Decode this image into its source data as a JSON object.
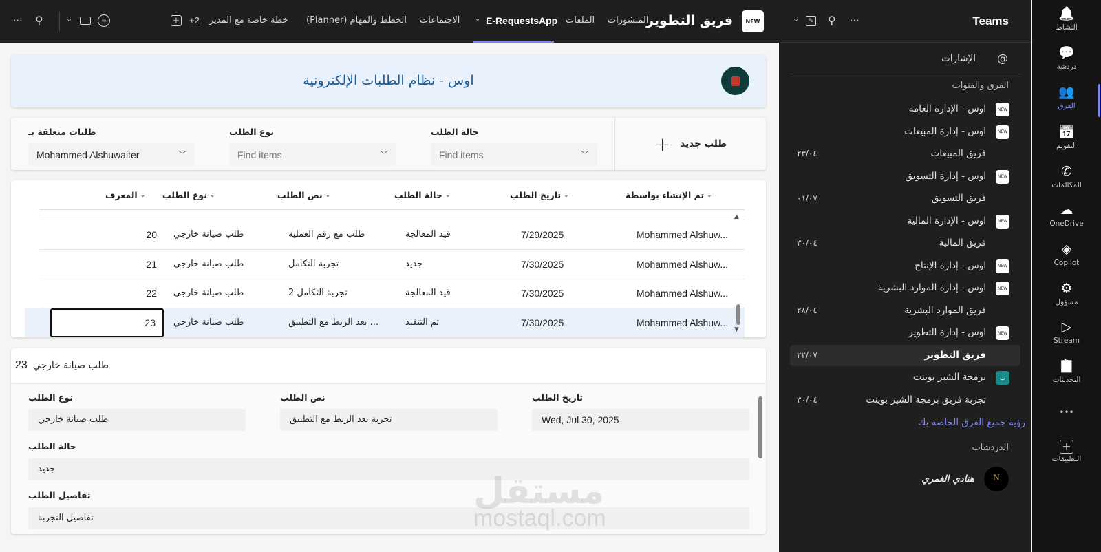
{
  "topbar": {
    "team_title": "فريق التطوير",
    "logo_text": "NEW",
    "tabs": [
      "المنشورات",
      "الملفات",
      "E-RequestsApp",
      "الاجتماعات",
      "الخطط والمهام (Planner)",
      "خطة خاصة مع المدير",
      "+2"
    ],
    "active_tab": "E-RequestsApp",
    "accent": "#7f85f5"
  },
  "app": {
    "title": "اوس - نظام الطلبات الإلكترونية",
    "new_request": "طلب جديد",
    "filters": [
      {
        "label": "حالة الطلب",
        "value": "",
        "placeholder": "Find items"
      },
      {
        "label": "نوع الطلب",
        "value": "",
        "placeholder": "Find items"
      },
      {
        "label": "طلبات متعلقة بـ",
        "value": "Mohammed Alshuwaiter",
        "placeholder": ""
      }
    ],
    "table": {
      "headers": [
        "المعرف",
        "نوع الطلب",
        "نص الطلب",
        "حالة الطلب",
        "تاريخ الطلب",
        "تم الإنشاء بواسطة"
      ],
      "rows": [
        [
          "20",
          "طلب صيانة خارجي",
          "طلب مع رقم العملية",
          "قيد المعالجة",
          "7/29/2025",
          "Mohammed Alshuw..."
        ],
        [
          "21",
          "طلب صيانة خارجي",
          "تجربة التكامل",
          "جديد",
          "7/30/2025",
          "Mohammed Alshuw..."
        ],
        [
          "22",
          "طلب صيانة خارجي",
          "تجربة التكامل 2",
          "قيد المعالجة",
          "7/30/2025",
          "Mohammed Alshuw..."
        ],
        [
          "23",
          "طلب صيانة خارجي",
          "... بعد الربط مع التطبيق",
          "تم التنفيذ",
          "7/30/2025",
          "Mohammed Alshuw..."
        ]
      ],
      "selected_index": 3
    },
    "detail": {
      "title": "طلب صيانة خارجي",
      "id": "23",
      "fields": {
        "type_label": "نوع الطلب",
        "type_value": "طلب صيانة خارجي",
        "text_label": "نص الطلب",
        "text_value": "تجربة بعد الربط مع التطبيق",
        "date_label": "تاريخ الطلب",
        "date_value": "Wed, Jul 30, 2025",
        "status_label": "حالة الطلب",
        "status_value": "جديد",
        "details_label": "تفاصيل الطلب",
        "details_value": "تفاصيل التجربة"
      }
    },
    "watermark": {
      "ar": "مستقل",
      "en": "mostaql.com"
    }
  },
  "panel": {
    "title": "Teams",
    "mentions": "الإشارات",
    "section_teams": "الفرق والقنوات",
    "items": [
      {
        "type": "team",
        "label": "اوس - الإدارة العامة"
      },
      {
        "type": "team",
        "label": "اوس - إدارة المبيعات"
      },
      {
        "type": "channel",
        "label": "فريق المبيعات",
        "date": "٢٣/٠٤"
      },
      {
        "type": "team",
        "label": "اوس - إدارة التسويق"
      },
      {
        "type": "channel",
        "label": "فريق التسويق",
        "date": "٠١/٠٧"
      },
      {
        "type": "team",
        "label": "اوس - الإدارة المالية"
      },
      {
        "type": "channel",
        "label": "فريق المالية",
        "date": "٣٠/٠٤"
      },
      {
        "type": "team",
        "label": "اوس - إدارة الإنتاج"
      },
      {
        "type": "team",
        "label": "اوس - إدارة الموارد البشرية"
      },
      {
        "type": "channel",
        "label": "فريق الموارد البشرية",
        "date": "٢٨/٠٤"
      },
      {
        "type": "team",
        "label": "اوس - إدارة التطوير"
      },
      {
        "type": "channel",
        "label": "فريق التطوير",
        "date": "٢٢/٠٧",
        "selected": true
      },
      {
        "type": "team2",
        "label": "برمجة الشير بوينت",
        "icon_text": "ب"
      },
      {
        "type": "channel",
        "label": "تجربة فريق برمجة الشير بوينت",
        "date": "٣٠/٠٤"
      }
    ],
    "see_all": "رؤية جميع الفرق الخاصة بك",
    "section_chats": "الدردشات",
    "chat_name": "هنادي الغمري",
    "chat_avatar": "N"
  },
  "rail": {
    "items": [
      {
        "label": "النشاط",
        "icon": "bell-icon",
        "glyph": "🔔"
      },
      {
        "label": "دردشة",
        "icon": "chat-icon",
        "glyph": "💬"
      },
      {
        "label": "الفرق",
        "icon": "teams-icon",
        "glyph": "👥",
        "active": true
      },
      {
        "label": "التقويم",
        "icon": "calendar-icon",
        "glyph": "📅"
      },
      {
        "label": "المكالمات",
        "icon": "phone-icon",
        "glyph": "✆"
      },
      {
        "label": "OneDrive",
        "icon": "cloud-icon",
        "glyph": "☁"
      },
      {
        "label": "Copilot",
        "icon": "copilot-icon",
        "glyph": "◈"
      },
      {
        "label": "مسؤول",
        "icon": "admin-icon",
        "glyph": "⚙"
      },
      {
        "label": "Stream",
        "icon": "stream-icon",
        "glyph": "▷"
      },
      {
        "label": "التحديثات",
        "icon": "updates-icon",
        "glyph": "📋"
      }
    ],
    "more": "•••",
    "apps_label": "التطبيقات",
    "active_color": "#7f85f5"
  }
}
